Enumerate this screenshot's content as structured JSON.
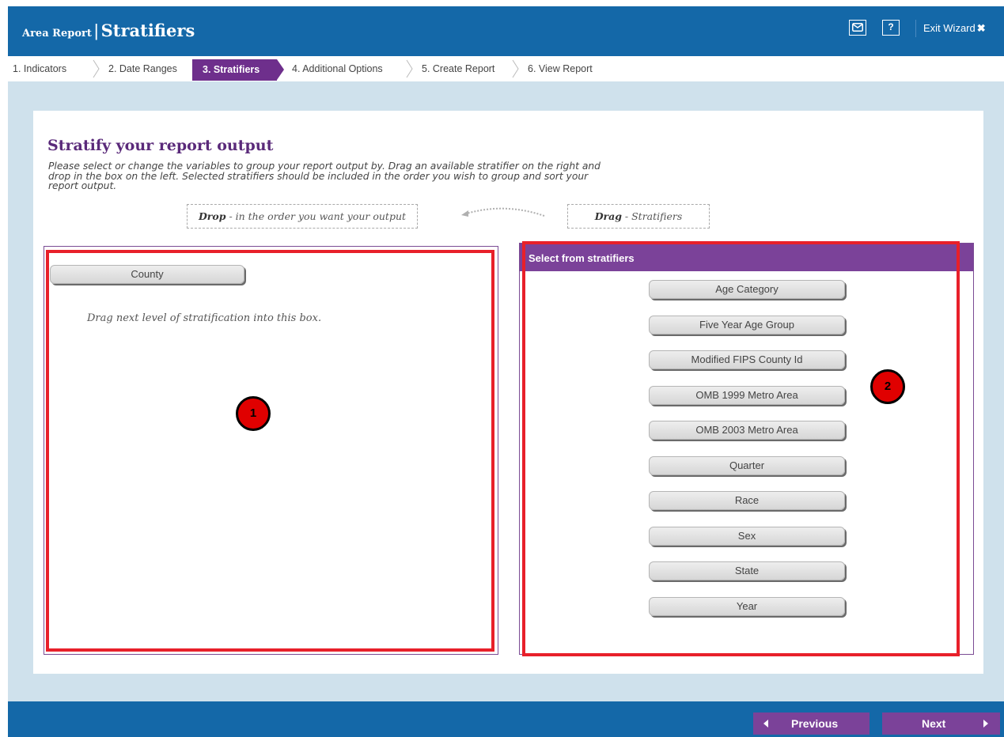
{
  "header": {
    "app_title": "Area Report",
    "separator": "|",
    "page_title": "Stratifiers",
    "help_label": "?",
    "exit_label": "Exit Wizard",
    "exit_mark": "✖"
  },
  "steps": [
    {
      "label": "1. Indicators",
      "active": false
    },
    {
      "label": "2. Date Ranges",
      "active": false
    },
    {
      "label": "3. Stratifiers",
      "active": true
    },
    {
      "label": "4. Additional Options",
      "active": false
    },
    {
      "label": "5. Create Report",
      "active": false
    },
    {
      "label": "6. View Report",
      "active": false
    }
  ],
  "main": {
    "heading": "Stratify your report output",
    "description": "Please select or change the variables to group your report output by. Drag an available stratifier on the right and drop in the box on the left. Selected stratifiers should be included in the order you wish to group and sort your report output.",
    "drop_hint_bold": "Drop",
    "drop_hint_rest": " - in the order you want your output",
    "drag_hint_bold": "Drag",
    "drag_hint_rest": " - Stratifiers"
  },
  "selected_panel": {
    "items": [
      "County"
    ],
    "placeholder": "Drag next level of stratification into this box."
  },
  "available_panel": {
    "title": "Select from stratifiers",
    "items": [
      "Age Category",
      "Five Year Age Group",
      "Modified FIPS County Id",
      "OMB 1999 Metro Area",
      "OMB 2003 Metro Area",
      "Quarter",
      "Race",
      "Sex",
      "State",
      "Year"
    ]
  },
  "annotations": {
    "marker_1": "1",
    "marker_2": "2",
    "highlight_color": "#e8202a"
  },
  "footer": {
    "previous_label": "Previous",
    "next_label": "Next"
  },
  "colors": {
    "header_blue": "#1468a8",
    "accent_purple": "#7b4299",
    "background": "#cfe1ec"
  }
}
